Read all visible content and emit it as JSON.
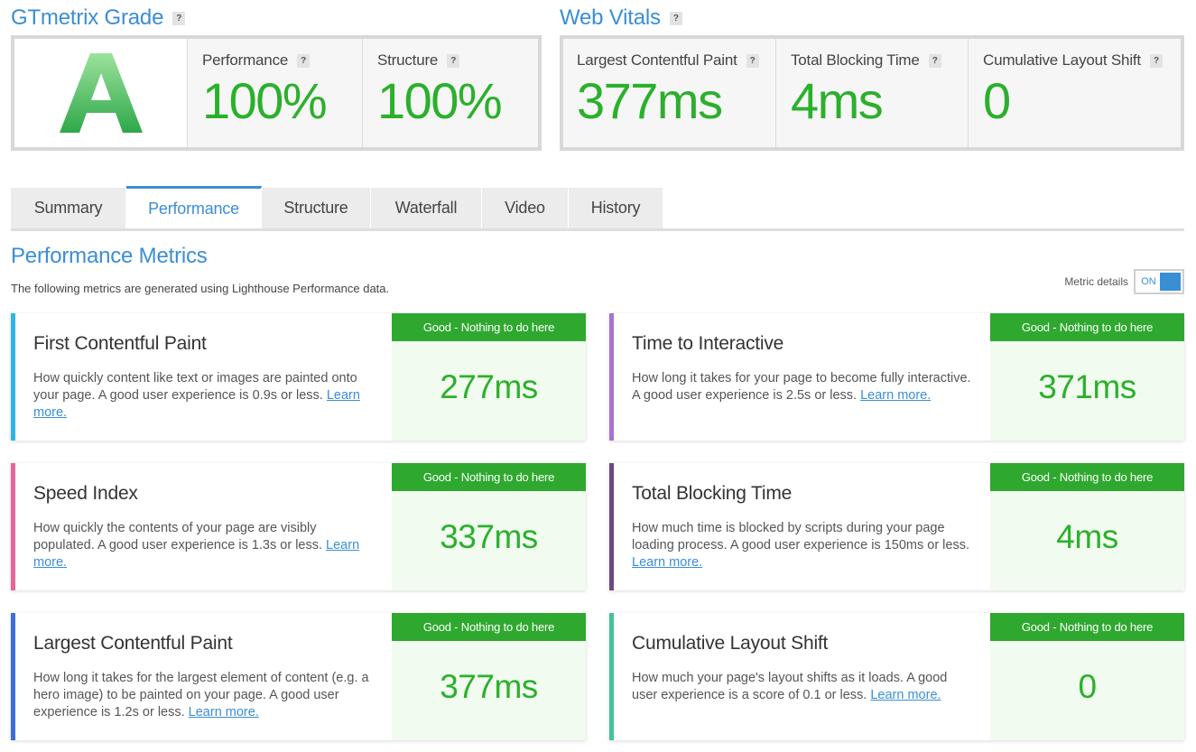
{
  "grade": {
    "title": "GTmetrix Grade",
    "help": "?",
    "letter": "A",
    "performance_label": "Performance",
    "performance_value": "100%",
    "structure_label": "Structure",
    "structure_value": "100%"
  },
  "vitals": {
    "title": "Web Vitals",
    "help": "?",
    "lcp_label": "Largest Contentful Paint",
    "lcp_value": "377ms",
    "tbt_label": "Total Blocking Time",
    "tbt_value": "4ms",
    "cls_label": "Cumulative Layout Shift",
    "cls_value": "0"
  },
  "tabs": [
    "Summary",
    "Performance",
    "Structure",
    "Waterfall",
    "Video",
    "History"
  ],
  "active_tab": "Performance",
  "metrics_section": {
    "title": "Performance Metrics",
    "subtitle": "The following metrics are generated using Lighthouse Performance data.",
    "toggle_label": "Metric details",
    "toggle_state": "ON"
  },
  "cards": [
    {
      "title": "First Contentful Paint",
      "desc": "How quickly content like text or images are painted onto your page. A good user experience is 0.9s or less.",
      "link": "Learn more.",
      "badge": "Good - Nothing to do here",
      "value": "277ms",
      "accent": "#2eb4e8"
    },
    {
      "title": "Time to Interactive",
      "desc": "How long it takes for your page to become fully interactive. A good user experience is 2.5s or less.",
      "link": "Learn more.",
      "badge": "Good - Nothing to do here",
      "value": "371ms",
      "accent": "#a873cf"
    },
    {
      "title": "Speed Index",
      "desc": "How quickly the contents of your page are visibly populated. A good user experience is 1.3s or less.",
      "link": "Learn more.",
      "badge": "Good - Nothing to do here",
      "value": "337ms",
      "accent": "#e8659c"
    },
    {
      "title": "Total Blocking Time",
      "desc": "How much time is blocked by scripts during your page loading process. A good user experience is 150ms or less.",
      "link": "Learn more.",
      "badge": "Good - Nothing to do here",
      "value": "4ms",
      "accent": "#6a4a82"
    },
    {
      "title": "Largest Contentful Paint",
      "desc": "How long it takes for the largest element of content (e.g. a hero image) to be painted on your page. A good user experience is 1.2s or less.",
      "link": "Learn more.",
      "badge": "Good - Nothing to do here",
      "value": "377ms",
      "accent": "#3b6fd8"
    },
    {
      "title": "Cumulative Layout Shift",
      "desc": "How much your page's layout shifts as it loads. A good user experience is a score of 0.1 or less.",
      "link": "Learn more.",
      "badge": "Good - Nothing to do here",
      "value": "0",
      "accent": "#45c39a"
    }
  ],
  "colors": {
    "brand_blue": "#3a8ed6",
    "good_green": "#2bb02b",
    "badge_green": "#2fa82f"
  }
}
